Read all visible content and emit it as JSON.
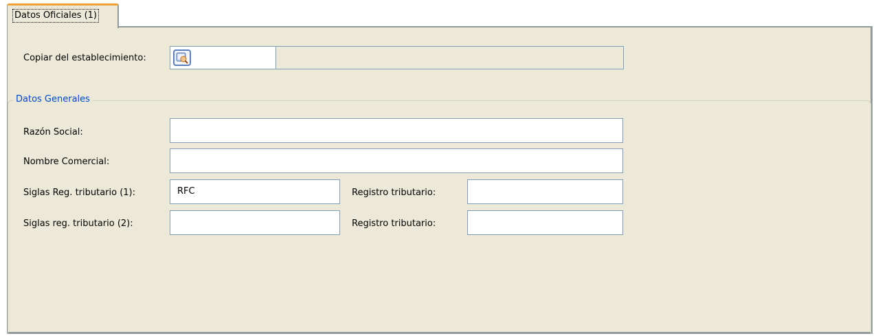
{
  "tabs": [
    {
      "label": "Datos Oficiales (1)"
    }
  ],
  "copy_from": {
    "label": "Copiar del establecimiento:",
    "code_value": "",
    "description_value": ""
  },
  "group": {
    "title": "Datos Generales"
  },
  "fields": {
    "razon_social": {
      "label": "Razón Social:",
      "value": ""
    },
    "nombre_comercial": {
      "label": "Nombre Comercial:",
      "value": ""
    },
    "siglas_1": {
      "label": "Siglas Reg. tributario (1):",
      "value": "RFC"
    },
    "registro_1": {
      "label": "Registro tributario:",
      "value": ""
    },
    "siglas_2": {
      "label": "Siglas reg. tributario (2):",
      "value": ""
    },
    "registro_2": {
      "label": "Registro tributario:",
      "value": ""
    }
  },
  "colors": {
    "panel_bg": "#ece9d8",
    "group_title": "#0046d5",
    "tab_accent": "#f0a030",
    "input_border": "#7f9db9"
  },
  "icons": {
    "lookup": "search-lookup-icon"
  }
}
